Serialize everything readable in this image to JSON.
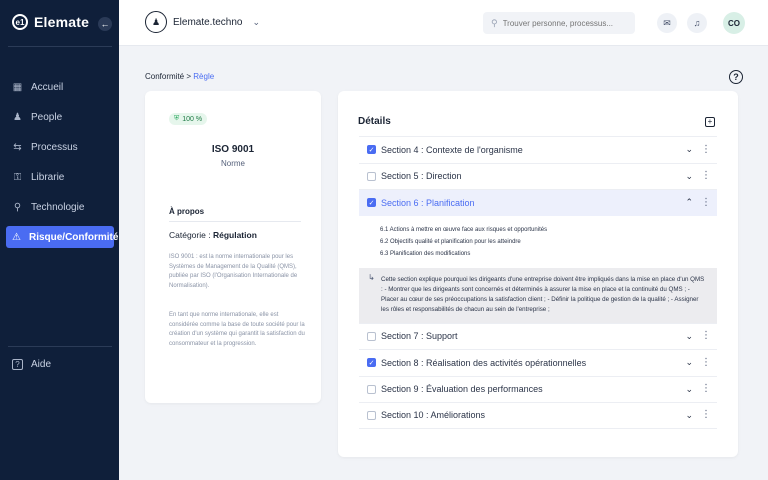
{
  "sidebar": {
    "brand": "Elemate",
    "brand_logo": "e1",
    "items": [
      {
        "label": "Accueil",
        "icon": "dashboard-icon"
      },
      {
        "label": "People",
        "icon": "people-icon"
      },
      {
        "label": "Processus",
        "icon": "process-icon"
      },
      {
        "label": "Librarie",
        "icon": "library-icon"
      },
      {
        "label": "Technologie",
        "icon": "technology-icon"
      },
      {
        "label": "Risque/Conformité",
        "icon": "warning-icon",
        "active": true
      }
    ],
    "help": "Aide"
  },
  "topbar": {
    "org_name": "Elemate.techno",
    "search_placeholder": "Trouver personne, processus...",
    "user_initials": "CO"
  },
  "breadcrumb": {
    "parent": "Conformité",
    "separator": ">",
    "current": "Règle"
  },
  "standard": {
    "badge": "100 %",
    "title": "ISO 9001",
    "subtitle": "Norme",
    "about_title": "À propos",
    "category_label": "Catégorie :",
    "category_value": "Régulation",
    "desc_1": "ISO 9001 : est la norme internationale pour les Systèmes de Management de la Qualité (QMS), publiée par ISO (l'Organisation Internationale de Normalisation).",
    "desc_2": "En tant que norme internationale, elle est considérée comme la base de toute société pour la création d'un système qui garantit la satisfaction du consommateur et la progression."
  },
  "details": {
    "title": "Détails",
    "sections": [
      {
        "label": "Section 4 : Contexte de l'organisme",
        "checked": true,
        "open": false
      },
      {
        "label": "Section 5 : Direction",
        "checked": false,
        "open": false
      },
      {
        "label": "Section 6 : Planification",
        "checked": true,
        "open": true
      },
      {
        "label": "Section 7 : Support",
        "checked": false,
        "open": false
      },
      {
        "label": "Section 8 : Réalisation des activités opérationnelles",
        "checked": true,
        "open": false
      },
      {
        "label": "Section 9 : Évaluation des performances",
        "checked": false,
        "open": false
      },
      {
        "label": "Section 10 : Améliorations",
        "checked": false,
        "open": false
      }
    ],
    "open_subitems": [
      "6.1 Actions à mettre en œuvre face aux risques et opportunités",
      "6.2 Objectifs qualité et planification pour les atteindre",
      "6.3 Planification des modifications"
    ],
    "explanation": "Cette section explique pourquoi les dirigeants d'une entreprise doivent être impliqués dans la mise en place d'un QMS : - Montrer que les dirigeants sont concernés et déterminés à assurer la mise en place et la continuité du QMS ; - Placer au cœur de ses préoccupations la satisfaction client ; - Définir la politique de gestion de la qualité ; - Assigner les rôles et responsabilités de chacun au sein de l'entreprise ;"
  },
  "colors": {
    "sidebar_bg": "#0f1f3a",
    "accent": "#4a6cf2",
    "badge_bg": "#e6f6ec"
  }
}
